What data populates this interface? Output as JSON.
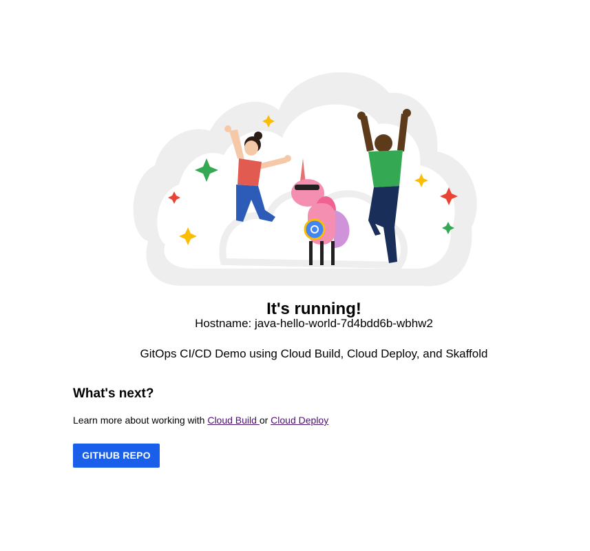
{
  "hero": {
    "illustration": "cloud-celebration-illustration",
    "colors": {
      "cloud": "#efefef",
      "sparkle_red": "#ea4335",
      "sparkle_yellow": "#fbbc04",
      "sparkle_green": "#34a853",
      "unicorn_pink": "#f48fb1",
      "badge_blue": "#4285f4"
    }
  },
  "main": {
    "title": "It's running!",
    "hostname_label": "Hostname: java-hello-world-7d4bdd6b-wbhw2",
    "tagline": "GitOps CI/CD Demo using Cloud Build, Cloud Deploy, and Skaffold"
  },
  "next": {
    "heading": "What's next?",
    "learn_prefix": "Learn more about working with ",
    "link_cloud_build": "Cloud Build ",
    "learn_or": "or ",
    "link_cloud_deploy": "Cloud Deploy"
  },
  "actions": {
    "github_button": "GITHUB REPO",
    "button_color": "#1a5fea",
    "link_color": "#4b0f6e"
  }
}
